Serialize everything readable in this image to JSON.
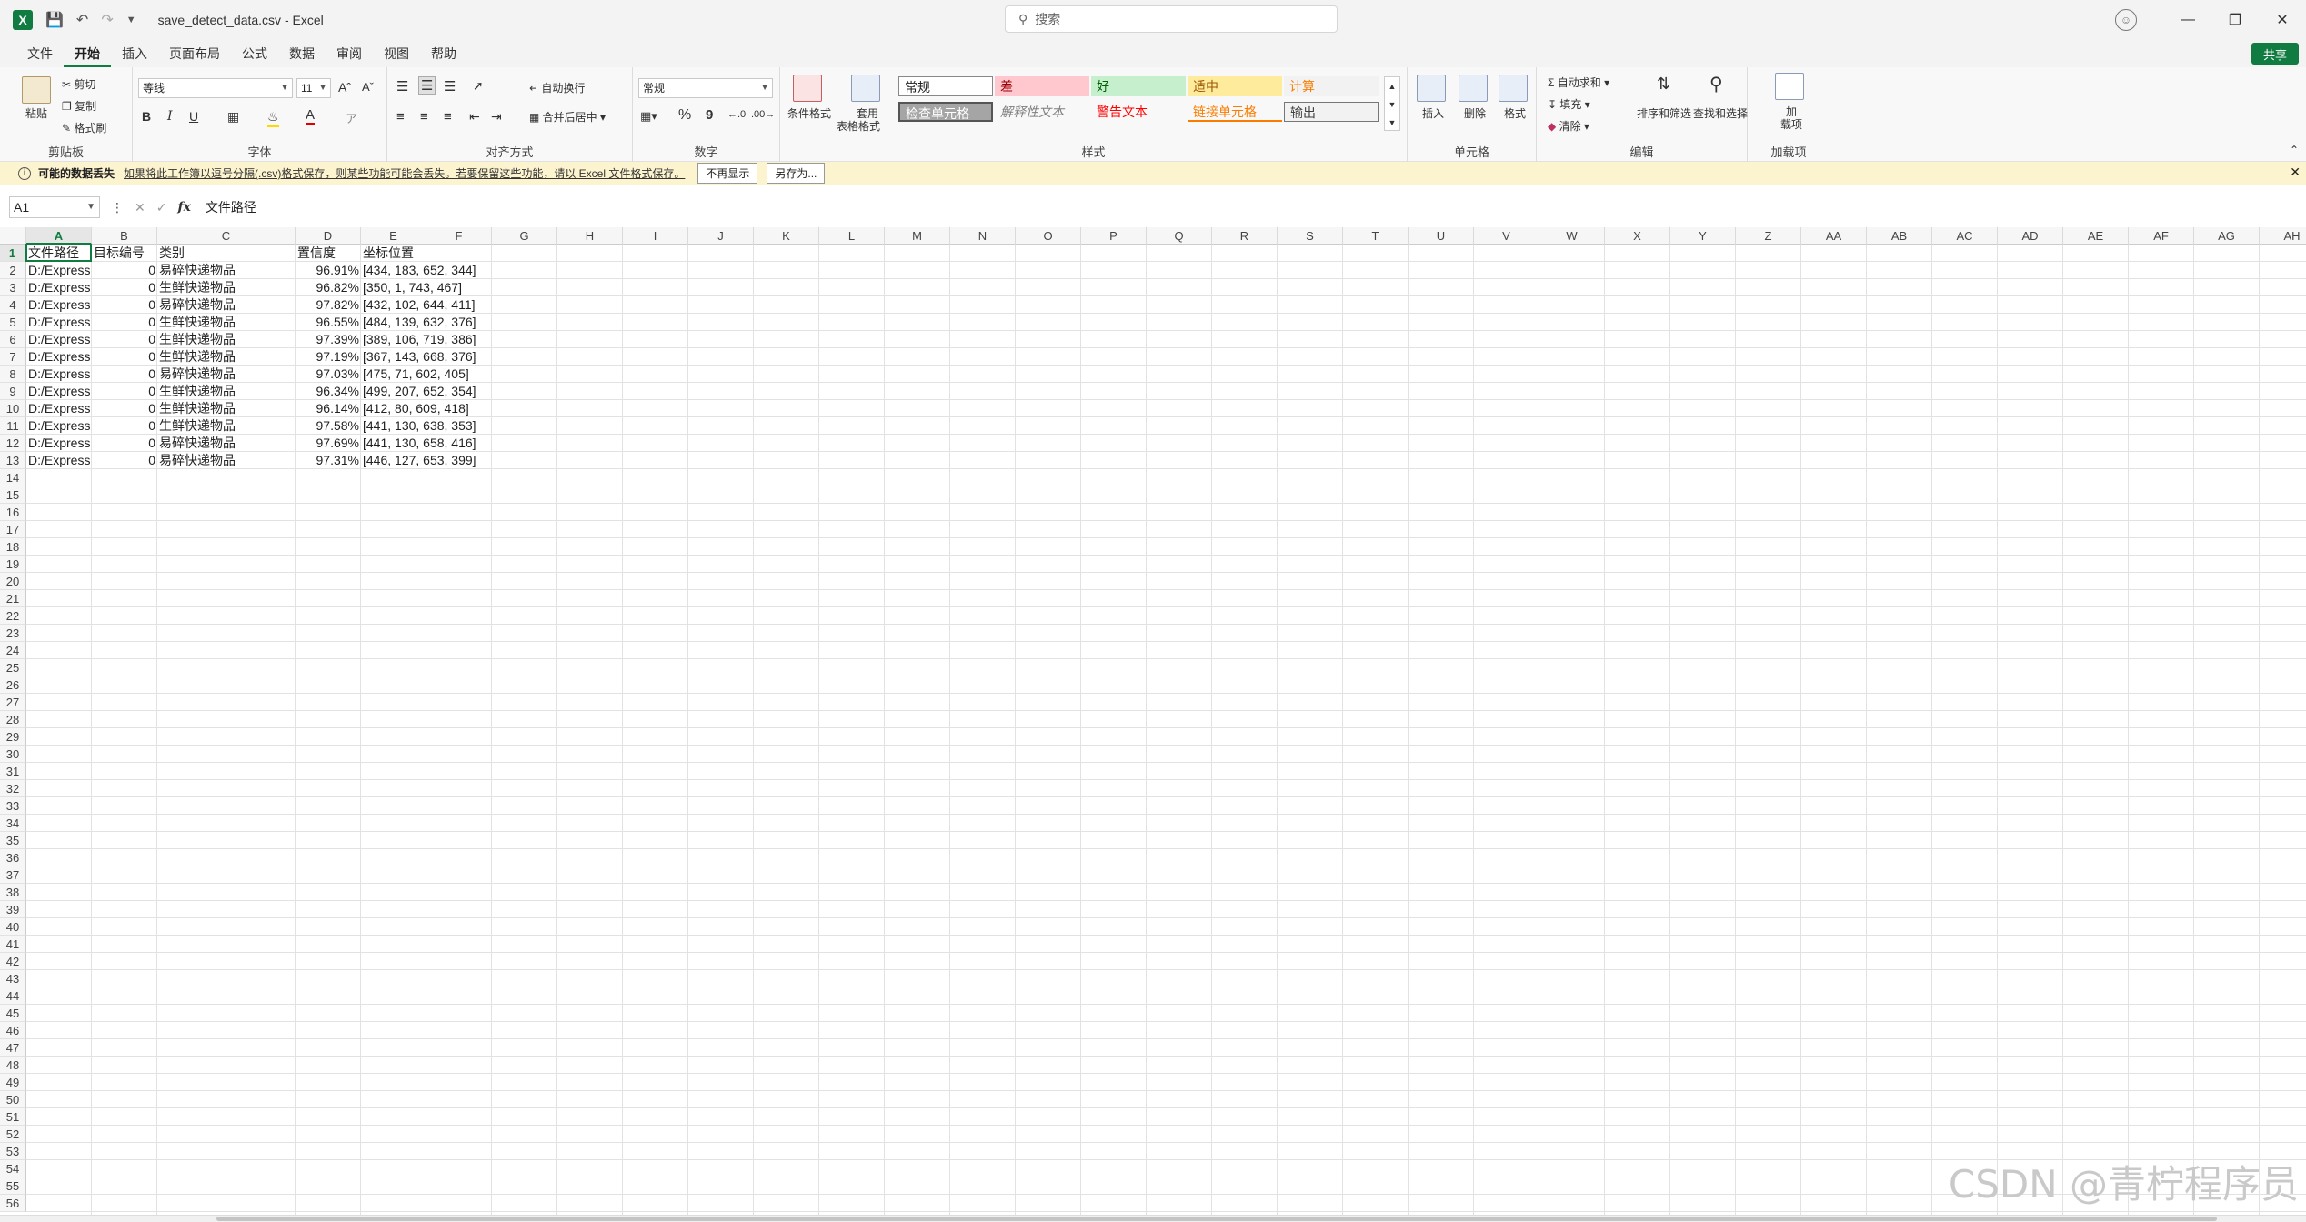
{
  "window": {
    "app_name": "Excel",
    "file_name": "save_detect_data.csv",
    "separator": "-",
    "search_placeholder": "搜索"
  },
  "menu": {
    "tabs": [
      "文件",
      "开始",
      "插入",
      "页面布局",
      "公式",
      "数据",
      "审阅",
      "视图",
      "帮助"
    ],
    "active_tab": "开始",
    "share_label": "共享"
  },
  "ribbon": {
    "clipboard": {
      "label": "剪贴板",
      "paste": "粘贴",
      "cut": "剪切",
      "copy": "复制",
      "format_painter": "格式刷"
    },
    "font": {
      "label": "字体",
      "font_name": "等线",
      "font_size": "11",
      "bold": "B",
      "italic": "I",
      "underline": "U"
    },
    "alignment": {
      "label": "对齐方式",
      "wrap_text": "自动换行",
      "merge_center": "合并后居中"
    },
    "number": {
      "label": "数字",
      "format": "常规",
      "percent": "%",
      "comma": "9"
    },
    "styles": {
      "label": "样式",
      "conditional_format": "条件格式",
      "table_format_line1": "套用",
      "table_format_line2": "表格格式",
      "cells": [
        {
          "text": "常规",
          "bg": "#ffffff",
          "color": "#222222"
        },
        {
          "text": "差",
          "bg": "#ffc7ce",
          "color": "#9c0006"
        },
        {
          "text": "好",
          "bg": "#c6efce",
          "color": "#006100"
        },
        {
          "text": "适中",
          "bg": "#ffeb9c",
          "color": "#9c5700"
        },
        {
          "text": "计算",
          "bg": "#f2f2f2",
          "color": "#fa7d00"
        },
        {
          "text": "检查单元格",
          "bg": "#a5a5a5",
          "color": "#ffffff"
        },
        {
          "text": "解释性文本",
          "bg": "#f8f8f8",
          "color": "#7f7f7f"
        },
        {
          "text": "警告文本",
          "bg": "#f8f8f8",
          "color": "#ff0000"
        },
        {
          "text": "链接单元格",
          "bg": "#f8f8f8",
          "color": "#fa7d00"
        },
        {
          "text": "输出",
          "bg": "#f2f2f2",
          "color": "#3f3f3f"
        }
      ]
    },
    "cells_group": {
      "label": "单元格",
      "insert": "插入",
      "delete": "删除",
      "format": "格式"
    },
    "editing": {
      "label": "编辑",
      "autosum": "自动求和",
      "fill": "填充",
      "clear": "清除",
      "sort_filter": "排序和筛选",
      "find_select": "查找和选择"
    },
    "addins": {
      "label": "加载项",
      "line1": "加",
      "line2": "载项"
    }
  },
  "message_bar": {
    "title": "可能的数据丢失",
    "text": "如果将此工作簿以逗号分隔(.csv)格式保存，则某些功能可能会丢失。若要保留这些功能，请以 Excel 文件格式保存。",
    "dont_show": "不再显示",
    "save_as": "另存为..."
  },
  "formula_bar": {
    "name_box": "A1",
    "content": "文件路径"
  },
  "columns": [
    "A",
    "B",
    "C",
    "D",
    "E",
    "F",
    "G",
    "H",
    "I",
    "J",
    "K",
    "L",
    "M",
    "N",
    "O",
    "P",
    "Q",
    "R",
    "S",
    "T",
    "U",
    "V",
    "W",
    "X",
    "Y",
    "Z",
    "AA",
    "AB",
    "AC",
    "AD",
    "AE",
    "AF",
    "AG",
    "AH"
  ],
  "headers": [
    "文件路径",
    "目标编号",
    "类别",
    "置信度",
    "坐标位置"
  ],
  "rows": [
    [
      "D:/Express",
      "0",
      "易碎快递物品",
      "96.91%",
      "[434, 183, 652, 344]"
    ],
    [
      "D:/Express",
      "0",
      "生鲜快递物品",
      "96.82%",
      "[350, 1, 743, 467]"
    ],
    [
      "D:/Express",
      "0",
      "易碎快递物品",
      "97.82%",
      "[432, 102, 644, 411]"
    ],
    [
      "D:/Express",
      "0",
      "生鲜快递物品",
      "96.55%",
      "[484, 139, 632, 376]"
    ],
    [
      "D:/Express",
      "0",
      "生鲜快递物品",
      "97.39%",
      "[389, 106, 719, 386]"
    ],
    [
      "D:/Express",
      "0",
      "生鲜快递物品",
      "97.19%",
      "[367, 143, 668, 376]"
    ],
    [
      "D:/Express",
      "0",
      "易碎快递物品",
      "97.03%",
      "[475, 71, 602, 405]"
    ],
    [
      "D:/Express",
      "0",
      "生鲜快递物品",
      "96.34%",
      "[499, 207, 652, 354]"
    ],
    [
      "D:/Express",
      "0",
      "生鲜快递物品",
      "96.14%",
      "[412, 80, 609, 418]"
    ],
    [
      "D:/Express",
      "0",
      "生鲜快递物品",
      "97.58%",
      "[441, 130, 638, 353]"
    ],
    [
      "D:/Express",
      "0",
      "易碎快递物品",
      "97.69%",
      "[441, 130, 658, 416]"
    ],
    [
      "D:/Express",
      "0",
      "易碎快递物品",
      "97.31%",
      "[446, 127, 653, 399]"
    ]
  ],
  "visible_row_count": 56,
  "watermark": "CSDN @青柠程序员"
}
